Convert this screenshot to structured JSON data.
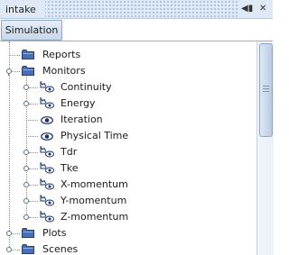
{
  "window": {
    "title": "intake"
  },
  "tab": {
    "label": "Simulation"
  },
  "tree": {
    "items": [
      {
        "label": "Reports",
        "icon": "folder-icon"
      },
      {
        "label": "Monitors",
        "icon": "folder-icon"
      },
      {
        "label": "Continuity",
        "icon": "monitor-plot-icon"
      },
      {
        "label": "Energy",
        "icon": "monitor-plot-icon"
      },
      {
        "label": "Iteration",
        "icon": "eye-icon"
      },
      {
        "label": "Physical Time",
        "icon": "eye-icon"
      },
      {
        "label": "Tdr",
        "icon": "monitor-plot-icon"
      },
      {
        "label": "Tke",
        "icon": "monitor-plot-icon"
      },
      {
        "label": "X-momentum",
        "icon": "monitor-plot-icon"
      },
      {
        "label": "Y-momentum",
        "icon": "monitor-plot-icon"
      },
      {
        "label": "Z-momentum",
        "icon": "monitor-plot-icon"
      },
      {
        "label": "Plots",
        "icon": "folder-icon"
      },
      {
        "label": "Scenes",
        "icon": "folder-icon"
      }
    ]
  }
}
